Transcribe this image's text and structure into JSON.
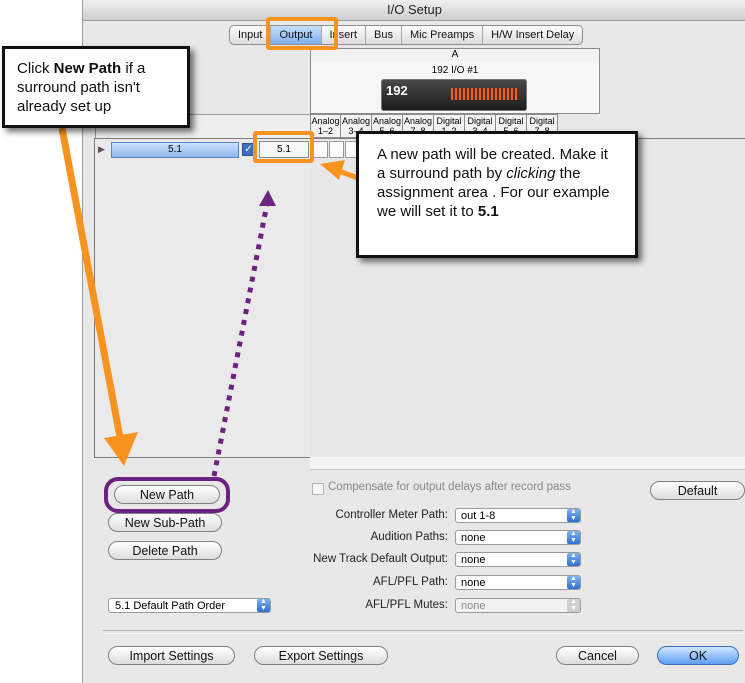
{
  "window": {
    "title": "I/O Setup"
  },
  "tabs": [
    "Input",
    "Output",
    "Insert",
    "Bus",
    "Mic Preamps",
    "H/W Insert Delay"
  ],
  "active_tab": "Output",
  "grid": {
    "header": "A",
    "device_name": "192 I/O #1",
    "device_logo": "192",
    "channels": [
      {
        "top": "Analog",
        "bottom": "1–2"
      },
      {
        "top": "Analog",
        "bottom": "3–4"
      },
      {
        "top": "Analog",
        "bottom": "5–6"
      },
      {
        "top": "Analog",
        "bottom": "7–8"
      },
      {
        "top": "Digital",
        "bottom": "1–2"
      },
      {
        "top": "Digital",
        "bottom": "3–4"
      },
      {
        "top": "Digital",
        "bottom": "5–6"
      },
      {
        "top": "Digital",
        "bottom": "7–8"
      }
    ]
  },
  "path_row": {
    "name": "5.1",
    "format": "5.1",
    "checked": true
  },
  "buttons": {
    "new_path": "New Path",
    "new_sub_path": "New Sub-Path",
    "delete_path": "Delete Path",
    "default": "Default",
    "import": "Import Settings",
    "export": "Export Settings",
    "cancel": "Cancel",
    "ok": "OK"
  },
  "compensate": {
    "label": "Compensate for output delays after record pass",
    "checked": false
  },
  "settings": [
    {
      "label": "Controller Meter Path:",
      "value": "out 1-8",
      "enabled": true
    },
    {
      "label": "Audition Paths:",
      "value": "none",
      "enabled": true
    },
    {
      "label": "New Track Default Output:",
      "value": "none",
      "enabled": true
    },
    {
      "label": "AFL/PFL Path:",
      "value": "none",
      "enabled": true
    },
    {
      "label": "AFL/PFL Mutes:",
      "value": "none",
      "enabled": false
    }
  ],
  "path_order": {
    "value": "5.1 Default Path Order"
  },
  "callouts": {
    "left": {
      "pre": "Click ",
      "bold": "New Path",
      "post": " if a surround path isn't already set up"
    },
    "right": {
      "line1": "A new path will be created. Make it a surround path by ",
      "italic": "clicking",
      "line2": " the assignment area . For our example we will set it to ",
      "bold": "5.1"
    }
  },
  "colors": {
    "highlight_orange": "#f7931e",
    "highlight_purple": "#6b2280",
    "selection_blue": "#8cb8ef"
  }
}
